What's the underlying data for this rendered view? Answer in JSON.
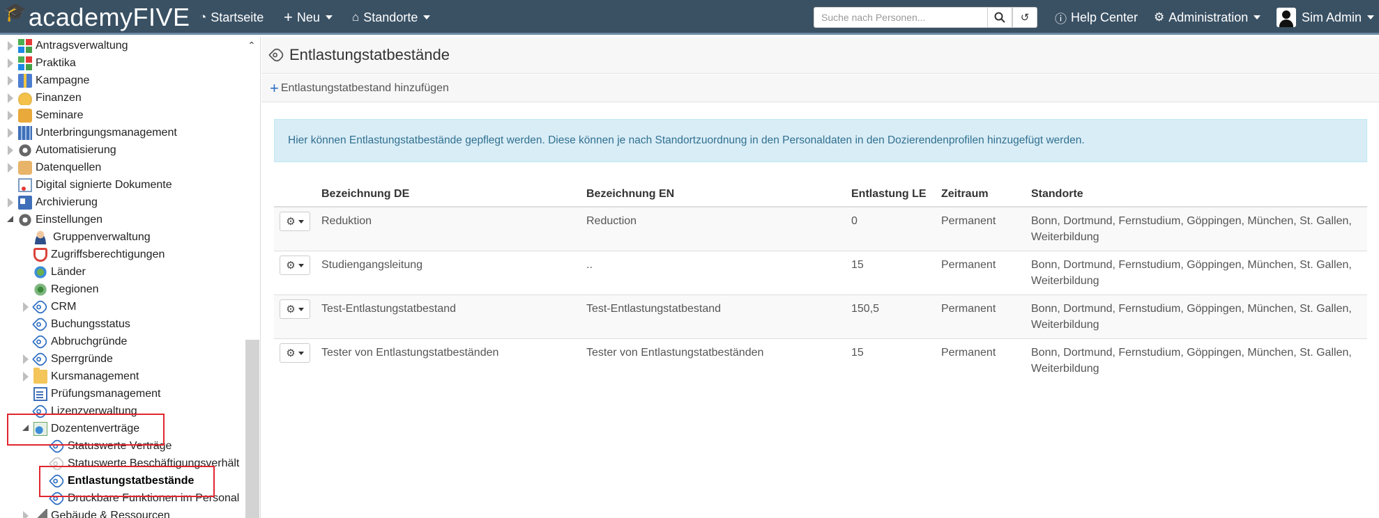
{
  "topbar": {
    "logo_text": "academyFIVE",
    "nav": [
      {
        "label": "Startseite",
        "icon": "dashboard-icon"
      },
      {
        "label": "Neu",
        "icon": "plus-icon"
      },
      {
        "label": "Standorte",
        "icon": "home-icon"
      }
    ],
    "search_placeholder": "Suche nach Personen...",
    "help_label": "Help Center",
    "admin_label": "Administration",
    "user_label": "Sim Admin"
  },
  "sidebar": {
    "items": [
      {
        "label": "Antragsverwaltung",
        "icon": "grid-icon"
      },
      {
        "label": "Praktika",
        "icon": "grid-icon"
      },
      {
        "label": "Kampagne",
        "icon": "gift-icon"
      },
      {
        "label": "Finanzen",
        "icon": "coins-icon"
      },
      {
        "label": "Seminare",
        "icon": "briefcase-icon"
      },
      {
        "label": "Unterbringungsmanagement",
        "icon": "building-icon"
      },
      {
        "label": "Automatisierung",
        "icon": "gear-icon"
      },
      {
        "label": "Datenquellen",
        "icon": "database-icon"
      },
      {
        "label": "Digital signierte Dokumente",
        "icon": "signed-document-icon"
      },
      {
        "label": "Archivierung",
        "icon": "id-card-icon"
      },
      {
        "label": "Einstellungen",
        "icon": "gear-icon"
      },
      {
        "label": "Gruppenverwaltung",
        "icon": "user-group-icon"
      },
      {
        "label": "Zugriffsberechtigungen",
        "icon": "shield-icon"
      },
      {
        "label": "Länder",
        "icon": "globe-icon"
      },
      {
        "label": "Regionen",
        "icon": "region-globe-icon"
      },
      {
        "label": "CRM",
        "icon": "tag-icon"
      },
      {
        "label": "Buchungsstatus",
        "icon": "tag-icon"
      },
      {
        "label": "Abbruchgründe",
        "icon": "tag-icon"
      },
      {
        "label": "Sperrgründe",
        "icon": "tag-icon"
      },
      {
        "label": "Kursmanagement",
        "icon": "folder-icon"
      },
      {
        "label": "Prüfungsmanagement",
        "icon": "exam-icon"
      },
      {
        "label": "Lizenzverwaltung",
        "icon": "tag-icon"
      },
      {
        "label": "Dozentenverträge",
        "icon": "contract-icon"
      },
      {
        "label": "Statuswerte Verträge",
        "icon": "tag-icon"
      },
      {
        "label": "Statuswerte Beschäftigungsverhält",
        "icon": "tag-icon"
      },
      {
        "label": "Entlastungstatbestände",
        "icon": "tag-icon"
      },
      {
        "label": "Druckbare Funktionen im Personal",
        "icon": "tag-icon"
      },
      {
        "label": "Gebäude & Ressourcen",
        "icon": "house-icon"
      }
    ]
  },
  "main": {
    "title": "Entlastungstatbestände",
    "add_label": "Entlastungstatbestand hinzufügen",
    "info_text": "Hier können Entlastungstatbestände gepflegt werden. Diese können je nach Standortzuordnung in den Personaldaten in den Dozierendenprofilen hinzugefügt werden.",
    "table": {
      "headers": [
        "Bezeichnung DE",
        "Bezeichnung EN",
        "Entlastung LE",
        "Zeitraum",
        "Standorte"
      ],
      "rows": [
        {
          "de": "Reduktion",
          "en": "Reduction",
          "le": "0",
          "zeitraum": "Permanent",
          "standorte_1": "Bonn, Dortmund, Fernstudium, Göppingen, München, St. Gallen,",
          "standorte_2": "Weiterbildung"
        },
        {
          "de": "Studiengangsleitung",
          "en": "..",
          "le": "15",
          "zeitraum": "Permanent",
          "standorte_1": "Bonn, Dortmund, Fernstudium, Göppingen, München, St. Gallen,",
          "standorte_2": "Weiterbildung"
        },
        {
          "de": "Test-Entlastungstatbestand",
          "en": "Test-Entlastungstatbestand",
          "le": "150,5",
          "zeitraum": "Permanent",
          "standorte_1": "Bonn, Dortmund, Fernstudium, Göppingen, München, St. Gallen,",
          "standorte_2": "Weiterbildung"
        },
        {
          "de": "Tester von Entlastungstatbeständen",
          "en": "Tester von Entlastungstatbeständen",
          "le": "15",
          "zeitraum": "Permanent",
          "standorte_1": "Bonn, Dortmund, Fernstudium, Göppingen, München, St. Gallen,",
          "standorte_2": "Weiterbildung"
        }
      ]
    }
  },
  "colors": {
    "topbar": "#3a5164",
    "info_bg": "#d9edf7",
    "info_text": "#31708f",
    "highlight_box": "#e0262e",
    "tag_icon": "#2e6fc2"
  }
}
